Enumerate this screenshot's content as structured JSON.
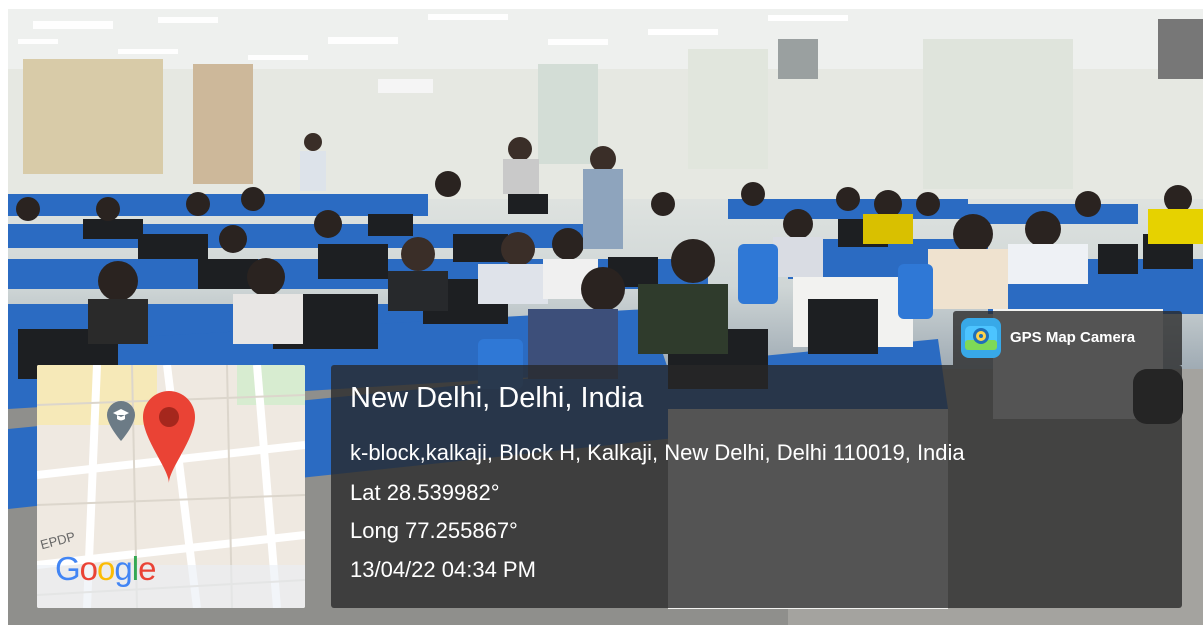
{
  "badge": {
    "label": "GPS Map Camera",
    "icon": "gps-map-camera-app-icon"
  },
  "location": {
    "title": "New Delhi, Delhi, India",
    "address": "k-block,kalkaji, Block H, Kalkaji, New Delhi, Delhi 110019, India",
    "lat": "Lat 28.539982°",
    "long": "Long 77.255867°",
    "datetime": "13/04/22 04:34 PM"
  },
  "map": {
    "logo_letters": [
      "G",
      "o",
      "o",
      "g",
      "l",
      "e"
    ],
    "road_label": "EPDP",
    "pin_color": "#ea4335",
    "place_icon": "graduation-cap-pin-icon"
  },
  "colors": {
    "desk_blue": "#2b6bc2",
    "overlay": "#282828"
  }
}
